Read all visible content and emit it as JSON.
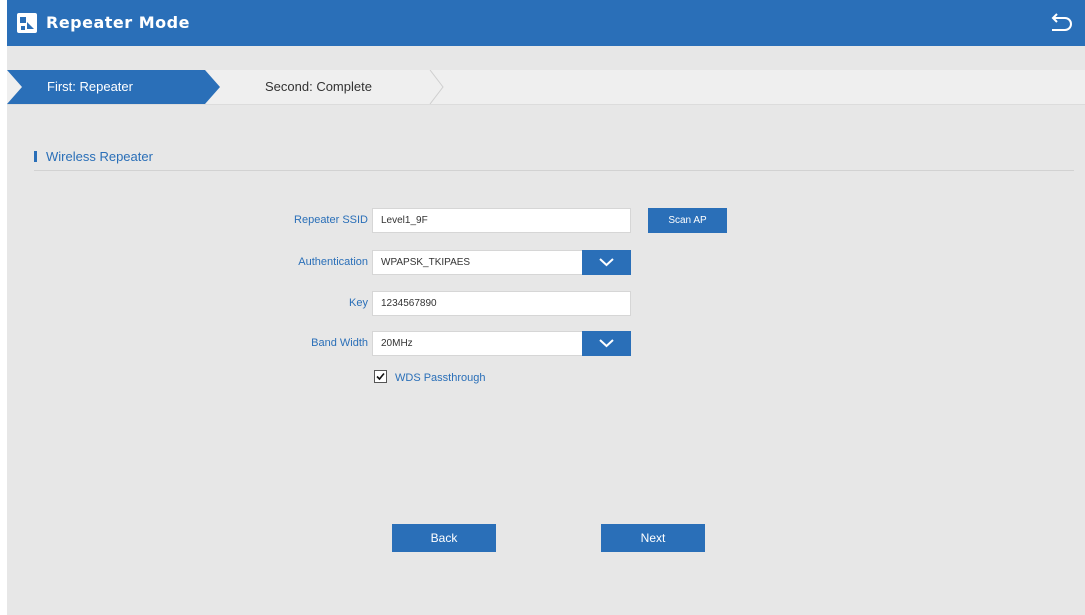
{
  "header": {
    "title": "Repeater Mode",
    "icon": "router-icon",
    "return_icon": "return-icon"
  },
  "steps": {
    "first": "First: Repeater",
    "second": "Second: Complete"
  },
  "section": {
    "title": "Wireless Repeater"
  },
  "form": {
    "ssid_label": "Repeater SSID",
    "ssid_value": "Level1_9F",
    "scan_label": "Scan AP",
    "auth_label": "Authentication",
    "auth_value": "WPAPSK_TKIPAES",
    "key_label": "Key",
    "key_value": "1234567890",
    "bandwidth_label": "Band Width",
    "bandwidth_value": "20MHz",
    "wds_label": "WDS Passthrough",
    "wds_checked": true
  },
  "buttons": {
    "back": "Back",
    "next": "Next"
  },
  "colors": {
    "accent": "#2a6fb8",
    "background": "#e7e7e7"
  }
}
